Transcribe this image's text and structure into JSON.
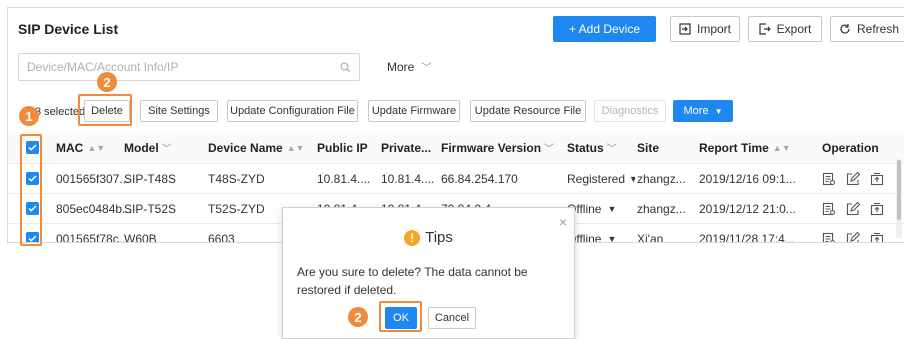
{
  "panel": {
    "title": "SIP Device List",
    "actions": {
      "add_device": "+ Add Device",
      "import": "Import",
      "export": "Export",
      "refresh": "Refresh"
    },
    "search": {
      "placeholder": "Device/MAC/Account Info/IP",
      "value": ""
    },
    "more_filter": "More",
    "selection": {
      "selected_text": "3 selected",
      "delete": "Delete",
      "site_settings": "Site Settings",
      "update_config": "Update Configuration File",
      "update_firmware": "Update Firmware",
      "update_resource": "Update Resource File",
      "diagnostics": "Diagnostics",
      "more": "More"
    }
  },
  "table": {
    "columns": [
      "MAC",
      "Model",
      "Device Name",
      "Public IP",
      "Private...",
      "Firmware Version",
      "Status",
      "Site",
      "Report Time",
      "Operation"
    ],
    "rows": [
      {
        "mac": "001565f307...",
        "model": "SIP-T48S",
        "name": "T48S-ZYD",
        "public_ip": "10.81.4....",
        "private_ip": "10.81.4....",
        "firmware": "66.84.254.170",
        "status": "Registered",
        "site": "zhangz...",
        "report_time": "2019/12/16 09:1..."
      },
      {
        "mac": "805ec0484b...",
        "model": "SIP-T52S",
        "name": "T52S-ZYD",
        "public_ip": "10.81.4....",
        "private_ip": "10.81.4....",
        "firmware": "70.84.0.4",
        "status": "Offline",
        "site": "zhangz...",
        "report_time": "2019/12/12 21:0..."
      },
      {
        "mac": "001565f78c...",
        "model": "W60B",
        "name": "6603",
        "public_ip": "",
        "private_ip": "",
        "firmware": "",
        "status": "Offline",
        "site": "Xi'an",
        "report_time": "2019/11/28 17:4..."
      }
    ]
  },
  "dialog": {
    "title": "Tips",
    "message": "Are you sure to delete? The data cannot be restored if deleted.",
    "ok": "OK",
    "cancel": "Cancel",
    "close": "×"
  },
  "annotations": {
    "step_one": "1",
    "step_two_a": "2",
    "step_two_b": "2"
  },
  "colors": {
    "primary": "#1e87f0",
    "highlight": "#f08a3c",
    "warning": "#f5a623"
  }
}
